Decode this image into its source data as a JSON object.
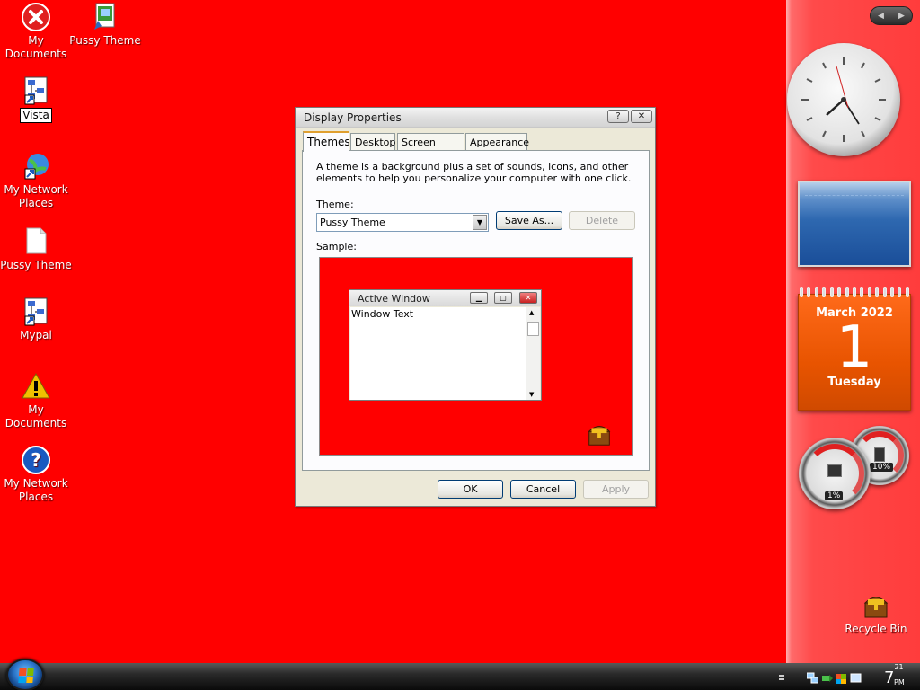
{
  "desktop": {
    "icons": [
      {
        "label": "My Documents",
        "icon": "red-x-error-icon"
      },
      {
        "label": "Pussy Theme",
        "icon": "theme-file-icon"
      },
      {
        "label": "Vista",
        "icon": "network-shortcut-icon"
      },
      {
        "label": "My Network Places",
        "icon": "network-globe-icon"
      },
      {
        "label": "Pussy Theme",
        "icon": "blank-document-icon"
      },
      {
        "label": "Mypal",
        "icon": "network-shortcut-icon"
      },
      {
        "label": "My Documents",
        "icon": "warning-icon"
      },
      {
        "label": "My Network Places",
        "icon": "help-question-icon"
      },
      {
        "label": "Recycle Bin",
        "icon": "treasure-chest-icon"
      }
    ]
  },
  "sidebar": {
    "calendar": {
      "month": "March 2022",
      "day": "1",
      "weekday": "Tuesday"
    },
    "meters": {
      "cpu": "1%",
      "memory": "10%"
    }
  },
  "dialog": {
    "title": "Display Properties",
    "help_btn": "?",
    "close_btn": "✕",
    "tabs": [
      "Themes",
      "Desktop",
      "Screen Saver",
      "Appearance"
    ],
    "description": "A theme is a background plus a set of sounds, icons, and other elements to help you personalize your computer with one click.",
    "theme_label": "Theme:",
    "theme_value": "Pussy Theme",
    "save_as": "Save As...",
    "delete": "Delete",
    "sample_label": "Sample:",
    "sample": {
      "window_title": "Active Window",
      "window_text": "Window Text"
    },
    "ok": "OK",
    "cancel": "Cancel",
    "apply": "Apply"
  },
  "taskbar": {
    "time_hour": "7",
    "time_min": "21",
    "ampm": "PM"
  },
  "colors": {
    "desktop": "#ff0000",
    "calendar": "#e85400"
  }
}
